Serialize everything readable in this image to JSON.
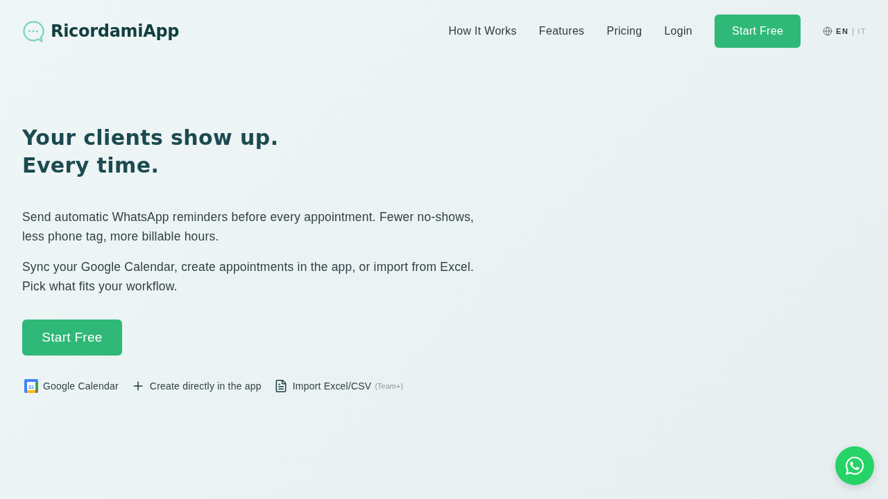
{
  "header": {
    "logo": "RicordamiApp",
    "nav": [
      {
        "label": "How It Works"
      },
      {
        "label": "Features"
      },
      {
        "label": "Pricing"
      },
      {
        "label": "Login"
      }
    ],
    "cta": "Start Free",
    "languages": [
      {
        "code": "EN",
        "selected": true
      },
      {
        "code": "IT",
        "selected": false
      }
    ],
    "language_separator": "|"
  },
  "hero": {
    "headline_lines": [
      "Your clients show up.",
      "Every time."
    ],
    "paragraphs": [
      "Send automatic WhatsApp reminders before every appointment. Fewer no-shows, less phone tag, more billable hours.",
      "Sync your Google Calendar, create appointments in the app, or import from Excel. Pick what fits your workflow."
    ],
    "cta": "Start Free",
    "sources": [
      {
        "kind": "calendar",
        "icon_text": "31",
        "label": "Google Calendar"
      },
      {
        "kind": "plus",
        "label": "Create directly in the app"
      },
      {
        "kind": "file",
        "label": "Import Excel/CSV",
        "note": "(Team+)"
      }
    ]
  }
}
